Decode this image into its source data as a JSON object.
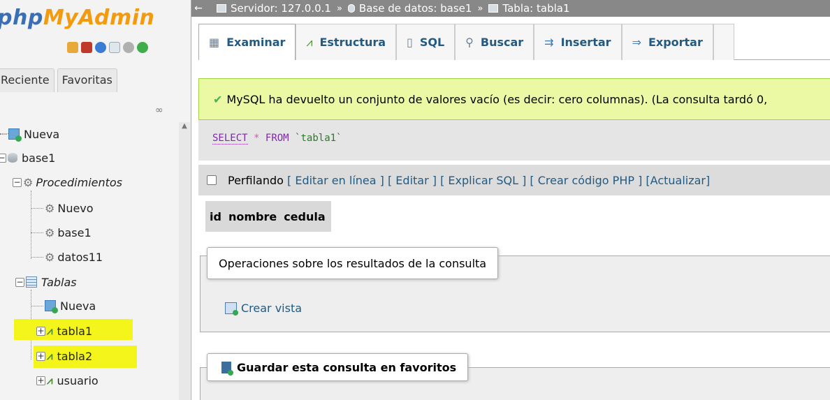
{
  "logo": {
    "part1": "php",
    "part2": "MyAdmin"
  },
  "nav": {
    "tabs": [
      "Reciente",
      "Favoritas"
    ],
    "quick_icons": [
      "home-icon",
      "database-icon",
      "help-icon",
      "docs-icon",
      "settings-icon",
      "reload-icon"
    ],
    "tree": {
      "nueva_root": "Nueva",
      "db": "base1",
      "procedimientos": "Procedimientos",
      "proc_items": [
        "Nuevo",
        "base1",
        "datos11"
      ],
      "tablas": "Tablas",
      "tablas_nueva": "Nueva",
      "tables": [
        "tabla1",
        "tabla2",
        "usuario"
      ]
    },
    "highlight_color": "#f4f51a"
  },
  "breadcrumb": {
    "servidor": "Servidor: 127.0.0.1",
    "base": "Base de datos: base1",
    "tabla": "Tabla: tabla1",
    "separator": "»"
  },
  "tabs": [
    {
      "label": "Examinar",
      "icon": "browse-icon",
      "active": true
    },
    {
      "label": "Estructura",
      "icon": "structure-icon"
    },
    {
      "label": "SQL",
      "icon": "sql-icon"
    },
    {
      "label": "Buscar",
      "icon": "search-icon"
    },
    {
      "label": "Insertar",
      "icon": "insert-icon"
    },
    {
      "label": "Exportar",
      "icon": "export-icon"
    }
  ],
  "success": {
    "message": "MySQL ha devuelto un conjunto de valores vacío (es decir: cero columnas). (La consulta tardó 0,"
  },
  "sql": {
    "select": "SELECT",
    "star": "*",
    "from": "FROM",
    "table": "`tabla1`"
  },
  "profiling": {
    "label": "Perfilando",
    "links": [
      "Editar en línea",
      "Editar",
      "Explicar SQL",
      "Crear código PHP",
      "Actualizar"
    ]
  },
  "columns": [
    "id",
    "nombre",
    "cedula"
  ],
  "operations": {
    "legend": "Operaciones sobre los resultados de la consulta",
    "crear_vista": "Crear vista"
  },
  "favorites": {
    "legend": "Guardar esta consulta en favoritos"
  },
  "colors": {
    "success_bg": "#ebf8a4",
    "link": "#235a81",
    "logo_php": "#3a6eb5",
    "logo_myadmin": "#f29b0f"
  }
}
